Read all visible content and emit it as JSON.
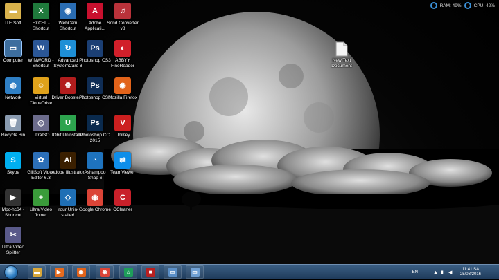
{
  "monitor": {
    "ram": "RAM: 49%",
    "cpu": "CPU: 42%"
  },
  "desktop_icons": [
    {
      "id": "itesoft",
      "label": "ITE Soft",
      "icon": "folder-icon",
      "color": "#d9b24c",
      "glyph": "▬"
    },
    {
      "id": "excel",
      "label": "EXCEL - Shortcut",
      "icon": "excel-icon",
      "color": "#1f7a3c",
      "glyph": "X"
    },
    {
      "id": "webcam",
      "label": "WebCam Shortcut",
      "icon": "webcam-icon",
      "color": "#2a6db3",
      "glyph": "◉"
    },
    {
      "id": "adobe",
      "label": "Adobe Applicati...",
      "icon": "adobe-icon",
      "color": "#c8102e",
      "glyph": "A"
    },
    {
      "id": "soundconverter",
      "label": "Sond Converter v8",
      "icon": "converter-icon",
      "color": "#b9323a",
      "glyph": "♫"
    },
    {
      "id": "computer",
      "label": "Computer",
      "icon": "computer-icon",
      "color": "#3d6e9e",
      "glyph": "▭"
    },
    {
      "id": "winword",
      "label": "WINWORD - Shortcut",
      "icon": "word-icon",
      "color": "#2b5797",
      "glyph": "W"
    },
    {
      "id": "advanced",
      "label": "Advanced SystemCare 8",
      "icon": "systemcare-icon",
      "color": "#1e8fd6",
      "glyph": "↻"
    },
    {
      "id": "photoshopcs3",
      "label": "Photoshop CS3",
      "icon": "photoshop-icon",
      "color": "#1b3f74",
      "glyph": "Ps"
    },
    {
      "id": "abbyy",
      "label": "ABBYY FineReader",
      "icon": "abbyy-icon",
      "color": "#d11f2a",
      "glyph": "◐"
    },
    {
      "id": "network",
      "label": "Network",
      "icon": "network-icon",
      "color": "#2f7fc4",
      "glyph": "◍"
    },
    {
      "id": "virtualclone",
      "label": "Virtual CloneDrive",
      "icon": "clonedrive-icon",
      "color": "#e0a21b",
      "glyph": "☺"
    },
    {
      "id": "driverbooster",
      "label": "Driver Booster 3",
      "icon": "driverbooster-icon",
      "color": "#b21d1d",
      "glyph": "⚙"
    },
    {
      "id": "photoshopcs6",
      "label": "Photoshop CS6",
      "icon": "photoshop-icon",
      "color": "#0f2d55",
      "glyph": "Ps"
    },
    {
      "id": "firefox",
      "label": "Mozilla Firefox",
      "icon": "firefox-icon",
      "color": "#e2631a",
      "glyph": "◉"
    },
    {
      "id": "recyclebin",
      "label": "Recycle Bin",
      "icon": "recycle-bin-icon",
      "color": "#8a9bb0",
      "glyph": "🗑"
    },
    {
      "id": "ultraiso",
      "label": "UltraISO",
      "icon": "ultraiso-icon",
      "color": "#6c6c8c",
      "glyph": "◎"
    },
    {
      "id": "iobit",
      "label": "IObit Uninstaller",
      "icon": "iobit-icon",
      "color": "#2da44e",
      "glyph": "U"
    },
    {
      "id": "photoshopcc",
      "label": "Photoshop CC 2015",
      "icon": "photoshop-icon",
      "color": "#0a2a4d",
      "glyph": "Ps"
    },
    {
      "id": "unikey",
      "label": "UniKey",
      "icon": "unikey-icon",
      "color": "#cc1f1f",
      "glyph": "V"
    },
    {
      "id": "skype",
      "label": "Skype",
      "icon": "skype-icon",
      "color": "#00aff0",
      "glyph": "S"
    },
    {
      "id": "gilisoft",
      "label": "GiliSoft Video Editor 6.3",
      "icon": "gilisoft-icon",
      "color": "#2c6fb8",
      "glyph": "✿"
    },
    {
      "id": "illustrator",
      "label": "Adobe Illustrator",
      "icon": "illustrator-icon",
      "color": "#3a1f00",
      "glyph": "Ai"
    },
    {
      "id": "ashampoo",
      "label": "Ashampoo Snap 6",
      "icon": "ashampoo-icon",
      "color": "#1e73be",
      "glyph": "◔"
    },
    {
      "id": "teamviewer",
      "label": "TeamViewer",
      "icon": "teamviewer-icon",
      "color": "#0e8ee9",
      "glyph": "⇄"
    },
    {
      "id": "mpchc",
      "label": "Mpc-hc64 - Shortcut",
      "icon": "mpc-icon",
      "color": "#333",
      "glyph": "▶"
    },
    {
      "id": "ultravideojoiner",
      "label": "Ultra Video Joiner",
      "icon": "videojoiner-icon",
      "color": "#3a9b3a",
      "glyph": "+"
    },
    {
      "id": "youruninstaller",
      "label": "Your Unin-staller!",
      "icon": "uninstaller-icon",
      "color": "#1f6fb5",
      "glyph": "◇"
    },
    {
      "id": "chrome",
      "label": "Google Chrome",
      "icon": "chrome-icon",
      "color": "#db4437",
      "glyph": "◉"
    },
    {
      "id": "ccleaner",
      "label": "CCleaner",
      "icon": "ccleaner-icon",
      "color": "#c8202a",
      "glyph": "C"
    },
    {
      "id": "ultravideosplitter",
      "label": "Ultra Video Splitter",
      "icon": "videosplitter-icon",
      "color": "#5a5a8a",
      "glyph": "✂"
    }
  ],
  "file_icon": {
    "label": "New Text Document",
    "icon": "text-document-icon"
  },
  "taskbar": {
    "items": [
      {
        "name": "explorer",
        "icon": "folder-icon",
        "color": "#d9a83a",
        "glyph": "▬"
      },
      {
        "name": "media-player",
        "icon": "media-player-icon",
        "color": "#e56b1f",
        "glyph": "▶"
      },
      {
        "name": "firefox",
        "icon": "firefox-icon",
        "color": "#e2631a",
        "glyph": "◉"
      },
      {
        "name": "chrome",
        "icon": "chrome-icon",
        "color": "#db4437",
        "glyph": "◉"
      },
      {
        "name": "app-green",
        "icon": "house-icon",
        "color": "#1e9e5a",
        "glyph": "⌂"
      },
      {
        "name": "app-red",
        "icon": "app-red-icon",
        "color": "#b82020",
        "glyph": "■"
      },
      {
        "name": "window-1",
        "icon": "window-icon",
        "color": "#5b8fc7",
        "glyph": "▭"
      },
      {
        "name": "window-2",
        "icon": "window-icon",
        "color": "#6fa0d4",
        "glyph": "▭"
      }
    ],
    "lang": "EN",
    "time": "11:41 SA",
    "date": "25/03/2016"
  }
}
